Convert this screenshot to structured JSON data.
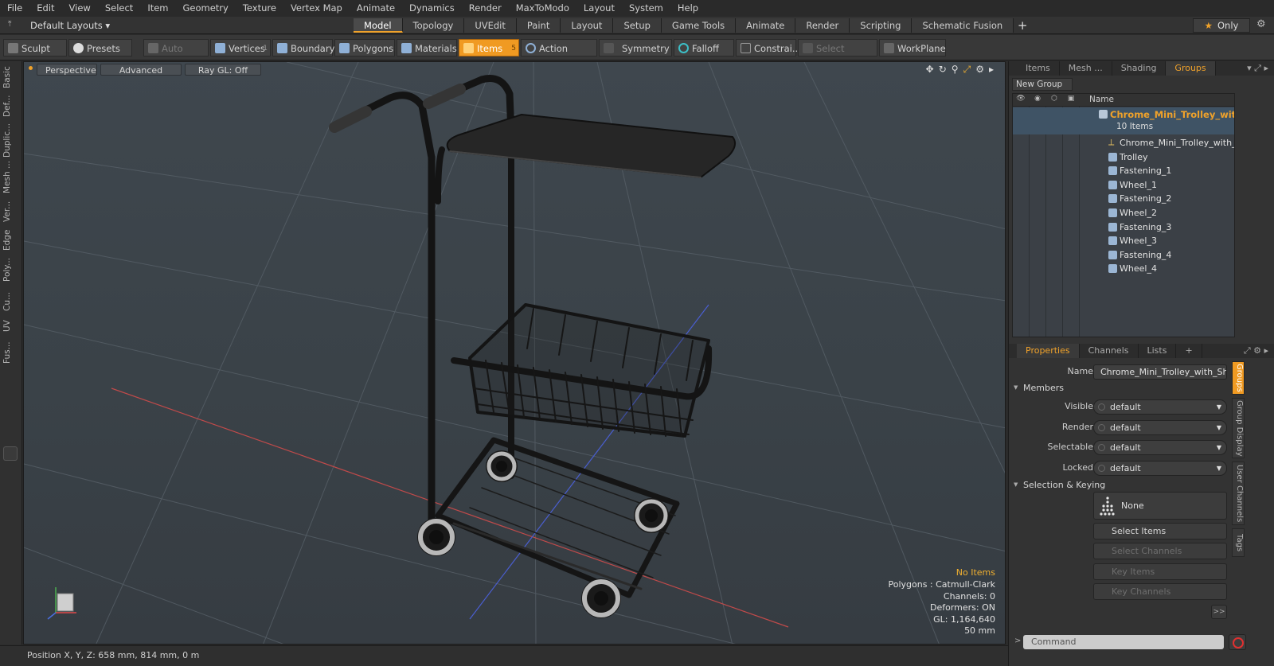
{
  "menu": [
    "File",
    "Edit",
    "View",
    "Select",
    "Item",
    "Geometry",
    "Texture",
    "Vertex Map",
    "Animate",
    "Dynamics",
    "Render",
    "MaxToModo",
    "Layout",
    "System",
    "Help"
  ],
  "layout_select": "Default Layouts ▾",
  "tabs": [
    "Model",
    "Topology",
    "UVEdit",
    "Paint",
    "Layout",
    "Setup",
    "Game Tools",
    "Animate",
    "Render",
    "Scripting",
    "Schematic Fusion"
  ],
  "only_label": "Only",
  "toolbar": {
    "sculpt": "Sculpt",
    "presets": "Presets",
    "auto_select": "Auto Select",
    "vertices": "Vertices",
    "vertices_count": "1",
    "boundary": "Boundary",
    "polygons": "Polygons",
    "materials": "Materials",
    "items": "Items",
    "items_count": "5",
    "action_center": "Action Center",
    "symmetry": "Symmetry",
    "falloff": "Falloff",
    "constraints": "Constrai...",
    "select_through": "Select Through",
    "workplane": "WorkPlane"
  },
  "left_tabs": [
    "Basic",
    "Def...",
    "Duplic...",
    "Mesh ...",
    "Ver...",
    "Edge",
    "Poly...",
    "Cu...",
    "UV",
    "Fus..."
  ],
  "viewport": {
    "perspective": "Perspective",
    "advanced": "Advanced",
    "raygl": "Ray GL: Off",
    "info": {
      "no_items": "No Items",
      "polygons": "Polygons : Catmull-Clark",
      "channels": "Channels: 0",
      "deformers": "Deformers: ON",
      "gl": "GL: 1,164,640",
      "scale": "50 mm"
    }
  },
  "status": {
    "position": "Position X, Y, Z:  658 mm, 814 mm, 0 m"
  },
  "right_tabs": [
    "Items",
    "Mesh ...",
    "Shading",
    "Groups"
  ],
  "new_group": "New Group",
  "tree": {
    "name_header": "Name",
    "group_name": "Chrome_Mini_Trolley_wit ...",
    "group_count": "10 Items",
    "items": [
      "Chrome_Mini_Trolley_with_ ...",
      "Trolley",
      "Fastening_1",
      "Wheel_1",
      "Fastening_2",
      "Wheel_2",
      "Fastening_3",
      "Wheel_3",
      "Fastening_4",
      "Wheel_4"
    ]
  },
  "props_tabs": [
    "Properties",
    "Channels",
    "Lists"
  ],
  "props": {
    "name_label": "Name",
    "name_value": "Chrome_Mini_Trolley_with_Shelf",
    "members": "Members",
    "visible_label": "Visible",
    "visible_value": "default",
    "render_label": "Render",
    "render_value": "default",
    "selectable_label": "Selectable",
    "selectable_value": "default",
    "locked_label": "Locked",
    "locked_value": "default",
    "selection_keying": "Selection & Keying",
    "none": "None",
    "select_items": "Select Items",
    "select_channels": "Select Channels",
    "key_items": "Key Items",
    "key_channels": "Key Channels",
    "more": ">>"
  },
  "right_side_tabs": [
    "Groups",
    "Group Display",
    "User Channels",
    "Tags"
  ],
  "command_placeholder": "Command",
  "colors": {
    "accent": "#f0a22a",
    "viewport_bg": "#3c444a",
    "selection_blue": "#3f5365"
  }
}
